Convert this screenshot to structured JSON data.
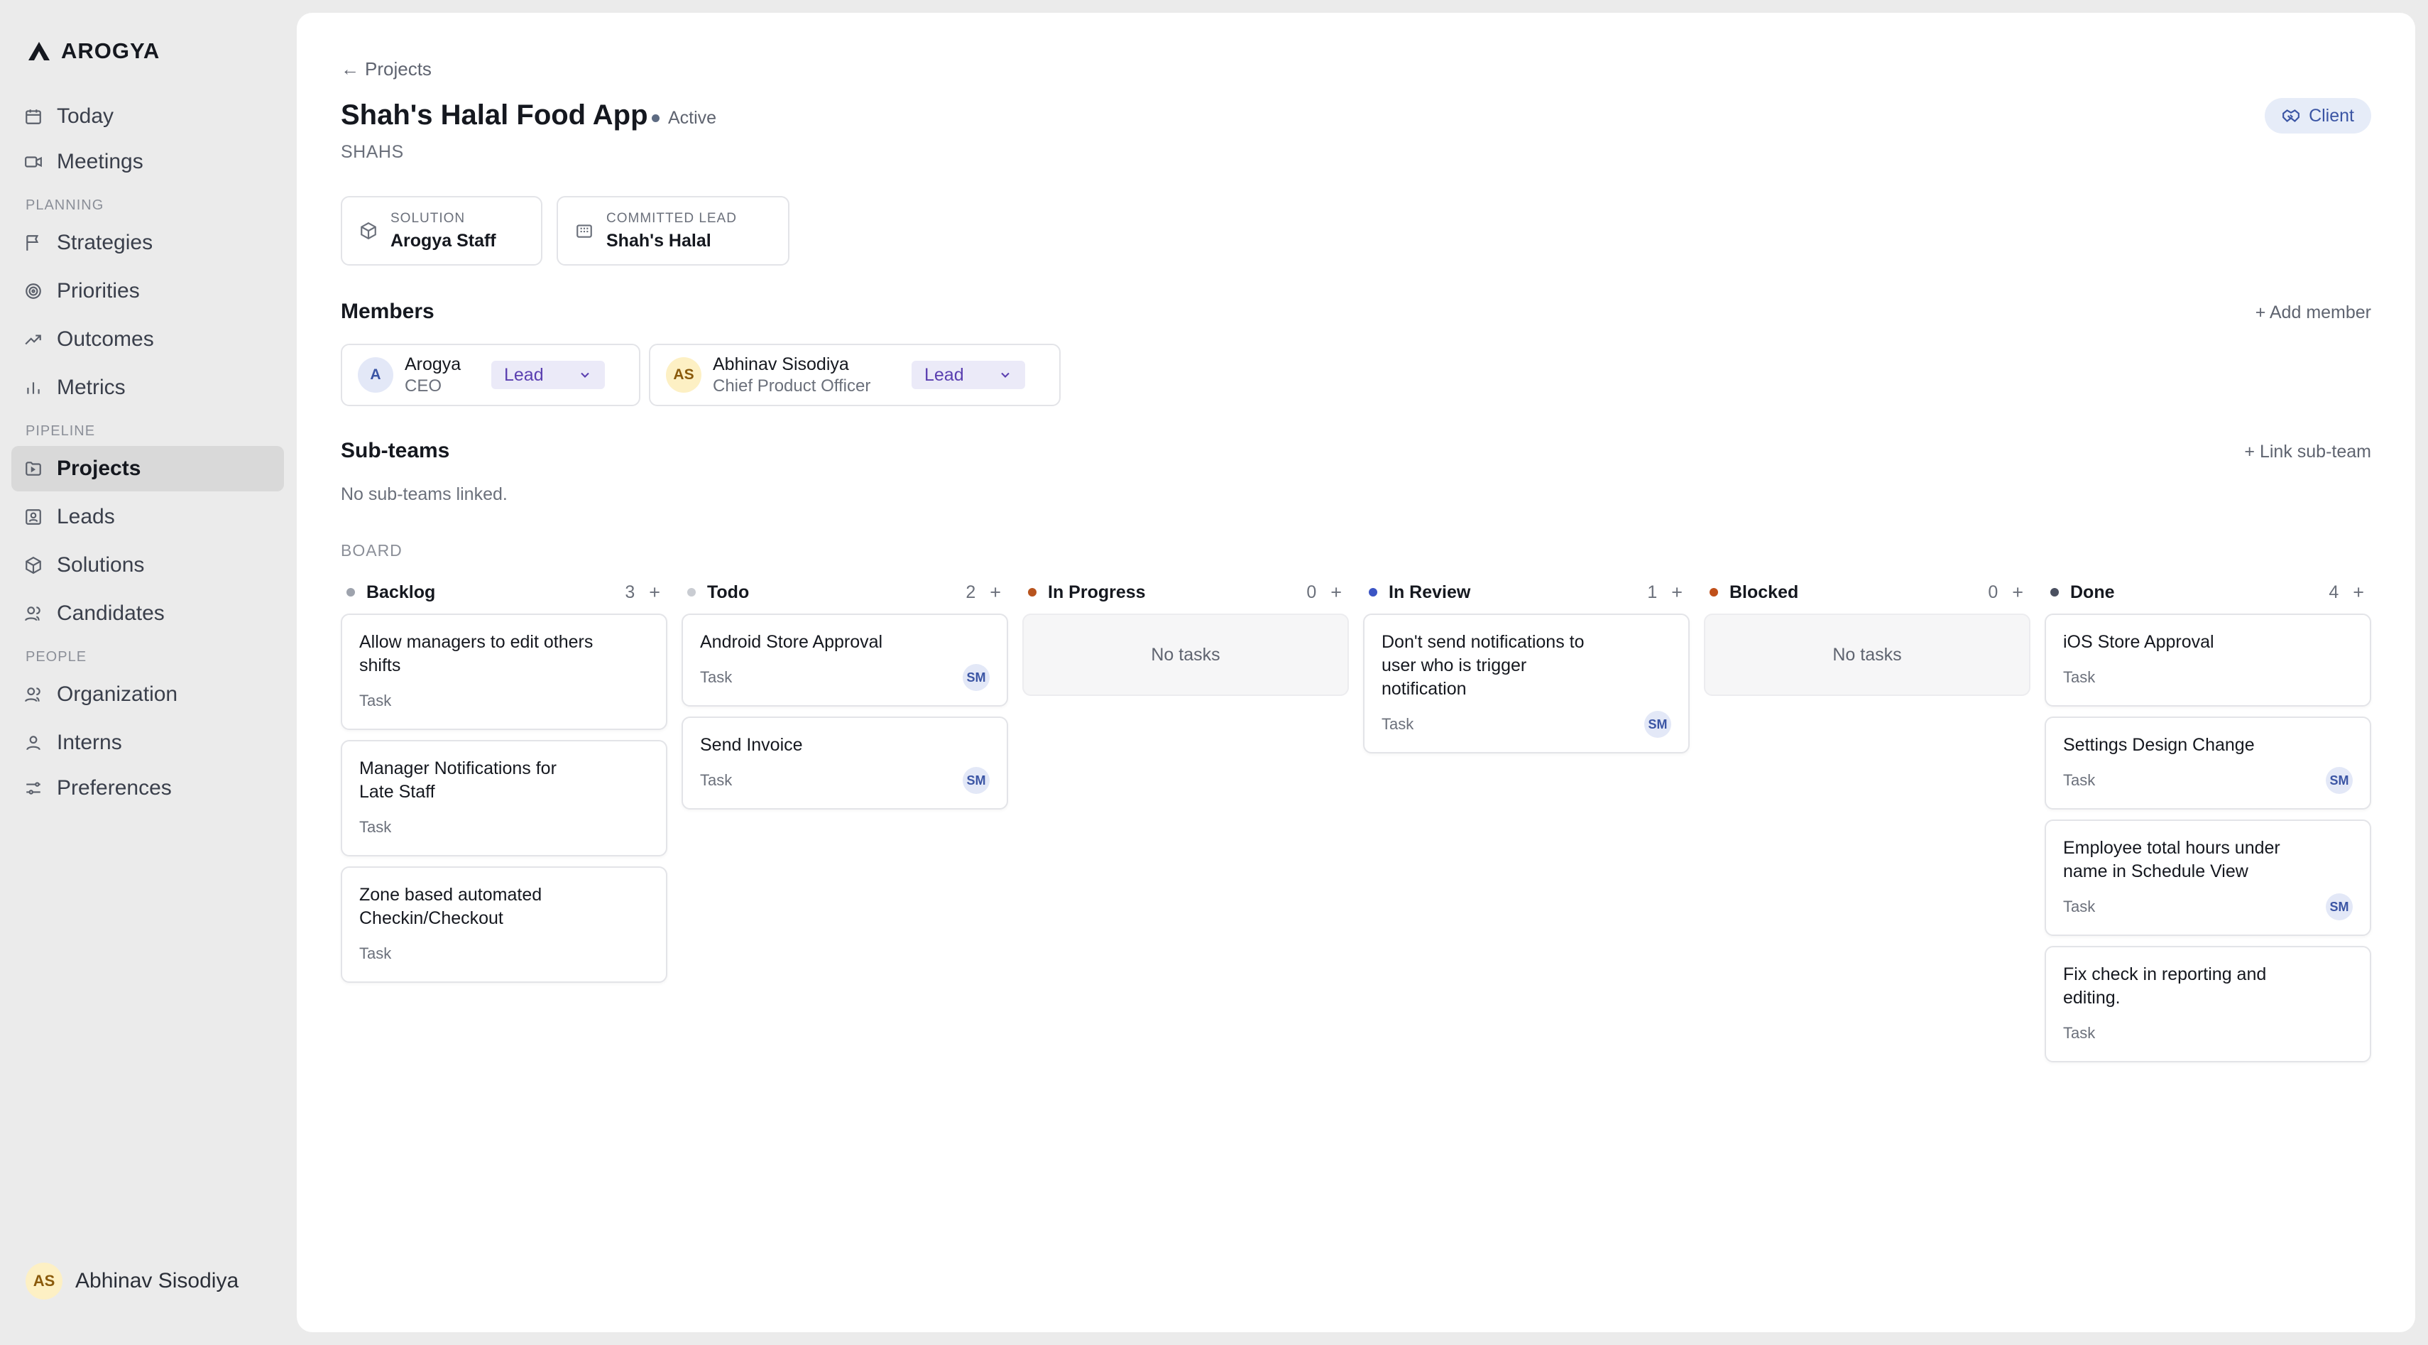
{
  "brand": {
    "name": "AROGYA"
  },
  "sidebar": {
    "items_top": [
      {
        "label": "Today",
        "icon": "calendar-icon"
      },
      {
        "label": "Meetings",
        "icon": "video-icon"
      }
    ],
    "planning_label": "PLANNING",
    "planning": [
      {
        "label": "Strategies",
        "icon": "flag-icon"
      },
      {
        "label": "Priorities",
        "icon": "target-icon"
      },
      {
        "label": "Outcomes",
        "icon": "trending-up-icon"
      },
      {
        "label": "Metrics",
        "icon": "bar-chart-icon"
      }
    ],
    "pipeline_label": "PIPELINE",
    "pipeline": [
      {
        "label": "Projects",
        "icon": "folder-icon",
        "active": true
      },
      {
        "label": "Leads",
        "icon": "contact-card-icon"
      },
      {
        "label": "Solutions",
        "icon": "box-icon"
      },
      {
        "label": "Candidates",
        "icon": "users-icon"
      }
    ],
    "people_label": "PEOPLE",
    "people": [
      {
        "label": "Organization",
        "icon": "users-icon"
      },
      {
        "label": "Interns",
        "icon": "user-icon"
      },
      {
        "label": "Preferences",
        "icon": "sliders-icon"
      }
    ],
    "user": {
      "initials": "AS",
      "name": "Abhinav Sisodiya"
    }
  },
  "project": {
    "back_label": "Projects",
    "title": "Shah's Halal Food App",
    "status": "Active",
    "code": "SHAHS",
    "client_label": "Client",
    "solution_label": "SOLUTION",
    "solution_value": "Arogya Staff",
    "lead_label": "COMMITTED LEAD",
    "lead_value": "Shah's Halal"
  },
  "members": {
    "title": "Members",
    "add_label": "+ Add member",
    "list": [
      {
        "initials": "A",
        "name": "Arogya",
        "role": "CEO",
        "access": "Lead"
      },
      {
        "initials": "AS",
        "name": "Abhinav Sisodiya",
        "role": "Chief Product Officer",
        "access": "Lead"
      }
    ]
  },
  "subteams": {
    "title": "Sub-teams",
    "link_label": "+ Link sub-team",
    "empty": "No sub-teams linked."
  },
  "board": {
    "label": "BOARD",
    "empty_text": "No tasks",
    "columns": [
      {
        "name": "Backlog",
        "count": "3",
        "color": "#9ea3ad",
        "cards": [
          {
            "title": "Allow managers to edit others shifts",
            "type": "Task",
            "assignee": ""
          },
          {
            "title": "Manager Notifications for Late Staff",
            "type": "Task",
            "assignee": ""
          },
          {
            "title": "Zone based automated Checkin/Checkout",
            "type": "Task",
            "assignee": ""
          }
        ]
      },
      {
        "name": "Todo",
        "count": "2",
        "color": "#c9ccd2",
        "cards": [
          {
            "title": "Android Store Approval",
            "type": "Task",
            "assignee": "SM"
          },
          {
            "title": "Send Invoice",
            "type": "Task",
            "assignee": "SM"
          }
        ]
      },
      {
        "name": "In Progress",
        "count": "0",
        "color": "#b8541e",
        "cards": []
      },
      {
        "name": "In Review",
        "count": "1",
        "color": "#3b55c4",
        "cards": [
          {
            "title": "Don't send notifications to user who is trigger notification",
            "type": "Task",
            "assignee": "SM"
          }
        ]
      },
      {
        "name": "Blocked",
        "count": "0",
        "color": "#c0501a",
        "cards": []
      },
      {
        "name": "Done",
        "count": "4",
        "color": "#4a5060",
        "cards": [
          {
            "title": "iOS Store Approval",
            "type": "Task",
            "assignee": ""
          },
          {
            "title": "Settings Design Change",
            "type": "Task",
            "assignee": "SM"
          },
          {
            "title": "Employee total hours under name in Schedule View",
            "type": "Task",
            "assignee": "SM"
          },
          {
            "title": "Fix check in reporting and editing.",
            "type": "Task",
            "assignee": ""
          }
        ]
      }
    ]
  }
}
